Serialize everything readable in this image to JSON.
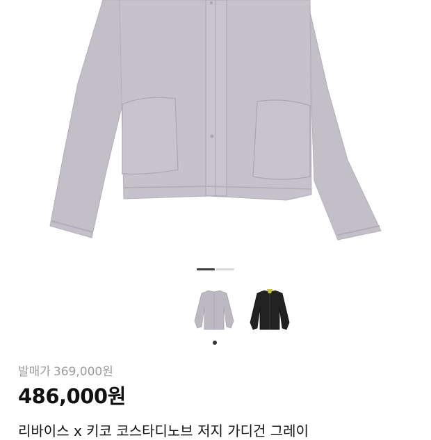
{
  "product": {
    "original_price_label": "발매가",
    "original_price": "369,000원",
    "sale_price": "486,000원",
    "title": "리바이스 x 키코 코스타디노브 저지 가디건 그레이"
  },
  "gallery": {
    "main_image": "gray-jersey-cardigan",
    "thumbnails": [
      {
        "name": "gray-cardigan-thumbnail",
        "color": "#bdb9c2"
      },
      {
        "name": "black-cardigan-thumbnail",
        "color": "#222222"
      }
    ],
    "page_index": 1,
    "page_count": 2
  },
  "colors": {
    "garment_gray": "#c3bfc8",
    "garment_black": "#232323",
    "price_text": "#111111",
    "muted_text": "#9b9b9b"
  }
}
